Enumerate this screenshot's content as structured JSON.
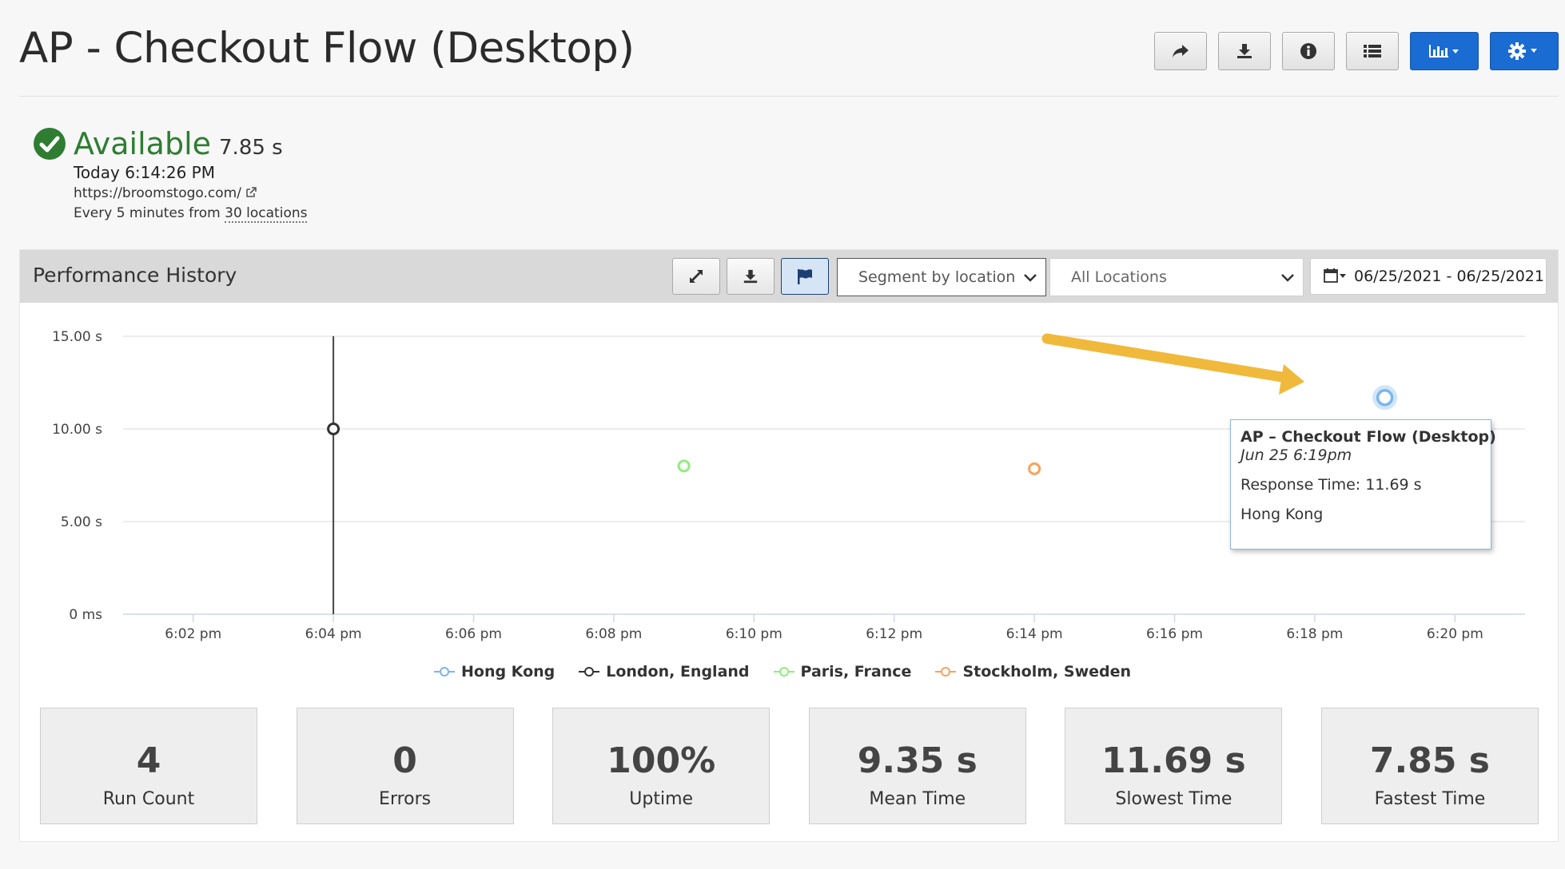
{
  "page": {
    "title": "AP - Checkout Flow (Desktop)"
  },
  "toolbar": {
    "share_icon": "share-icon",
    "download_icon": "download-icon",
    "info_icon": "info-icon",
    "list_icon": "list-icon",
    "chart_menu_icon": "bar-chart-icon",
    "settings_menu_icon": "gear-icon",
    "primary_color": "#1a6bd2"
  },
  "status": {
    "state": "Available",
    "response_time": "7.85 s",
    "last_run": "Today 6:14:26 PM",
    "url": "https://broomstogo.com/",
    "frequency_prefix": "Every 5 minutes from ",
    "locations_link": "30 locations",
    "color": "#2e7d32"
  },
  "performance": {
    "title": "Performance History",
    "segment_select": "Segment by location",
    "location_select": "All Locations",
    "date_range": "06/25/2021 - 06/25/2021"
  },
  "chart_data": {
    "type": "scatter",
    "y_ticks": [
      "15.00 s",
      "10.00 s",
      "5.00 s",
      "0 ms"
    ],
    "x_ticks": [
      "6:02 pm",
      "6:04 pm",
      "6:06 pm",
      "6:08 pm",
      "6:10 pm",
      "6:12 pm",
      "6:14 pm",
      "6:16 pm",
      "6:18 pm",
      "6:20 pm"
    ],
    "ylim": [
      0,
      15
    ],
    "xlim": [
      "6:01 pm",
      "6:21 pm"
    ],
    "grid": true,
    "legend_position": "bottom-center",
    "series": [
      {
        "name": "Hong Kong",
        "color": "#7cb5ec",
        "points": [
          {
            "x": "6:19 pm",
            "y": 11.69
          }
        ]
      },
      {
        "name": "London, England",
        "color": "#333333",
        "points": [
          {
            "x": "6:04 pm",
            "y": 10.0
          }
        ]
      },
      {
        "name": "Paris, France",
        "color": "#90ed7d",
        "points": [
          {
            "x": "6:09 pm",
            "y": 8.0
          }
        ]
      },
      {
        "name": "Stockholm, Sweden",
        "color": "#f7a35c",
        "points": [
          {
            "x": "6:14 pm",
            "y": 7.85
          }
        ]
      }
    ]
  },
  "tooltip": {
    "title": "AP – Checkout Flow (Desktop)",
    "time": "Jun 25 6:19pm",
    "response": "Response Time: 11.69 s",
    "location": "Hong Kong"
  },
  "stats": [
    {
      "value": "4",
      "label": "Run Count"
    },
    {
      "value": "0",
      "label": "Errors"
    },
    {
      "value": "100%",
      "label": "Uptime"
    },
    {
      "value": "9.35 s",
      "label": "Mean Time"
    },
    {
      "value": "11.69 s",
      "label": "Slowest Time"
    },
    {
      "value": "7.85 s",
      "label": "Fastest Time"
    }
  ]
}
